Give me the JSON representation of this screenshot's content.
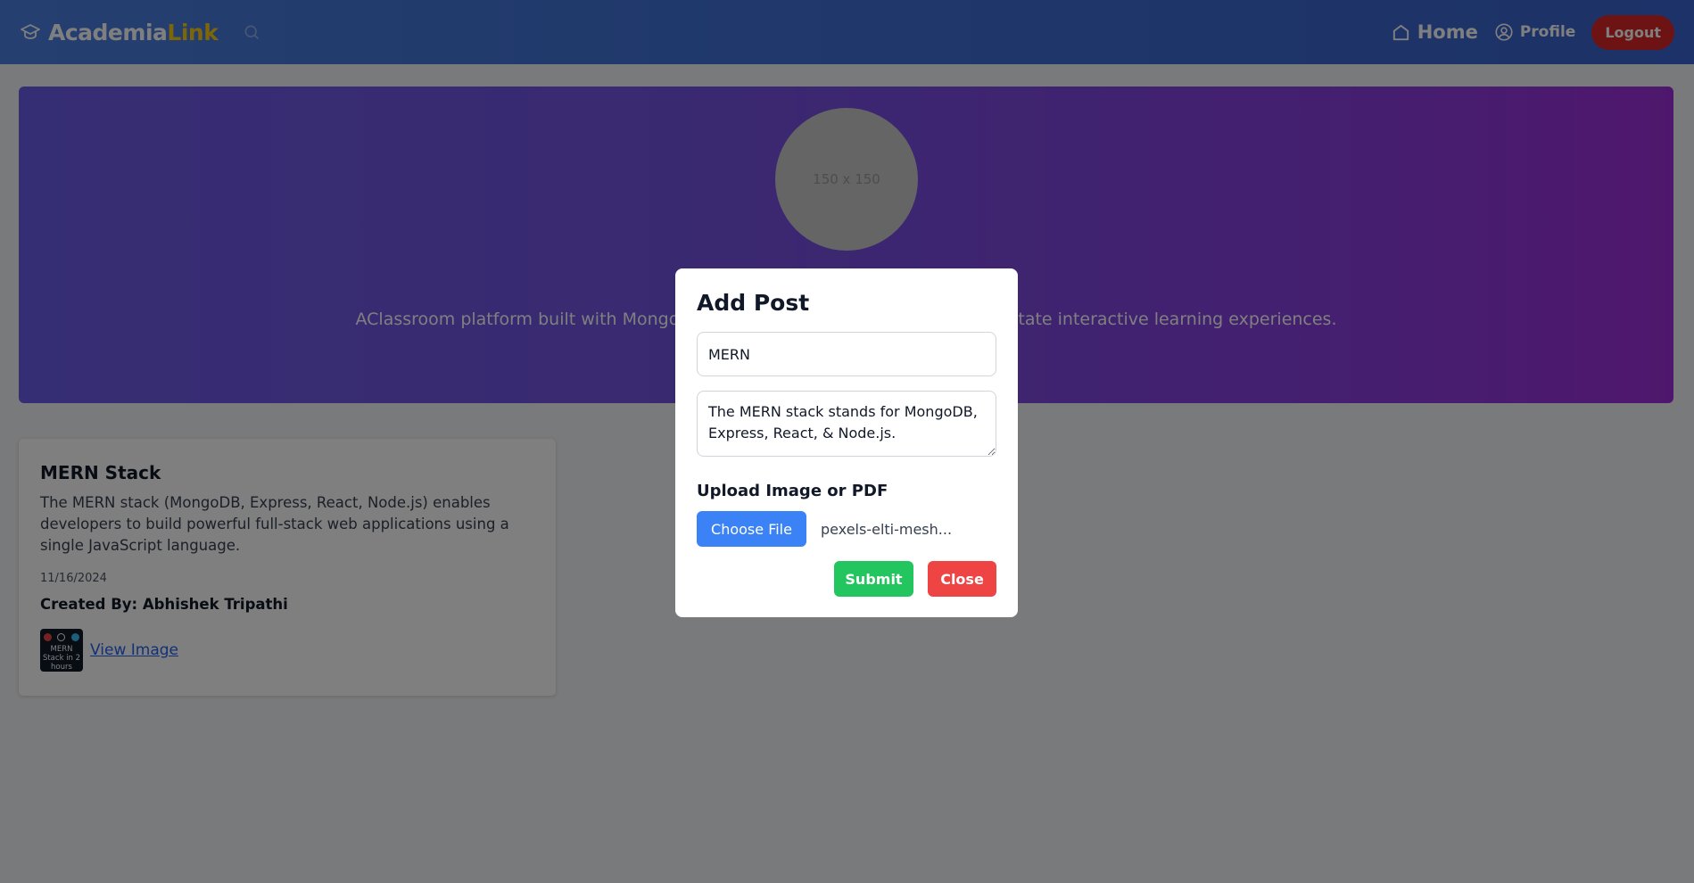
{
  "navbar": {
    "brand_primary": "Academia",
    "brand_accent": "Link",
    "home_label": "Home",
    "profile_label": "Profile",
    "logout_label": "Logout",
    "icons": [
      "graduation-cap-icon",
      "search-icon",
      "home-icon",
      "user-circle-icon"
    ]
  },
  "hero": {
    "avatar_placeholder": "150 x 150",
    "description": "AClassroom platform built with MongoDB, Express, React, and Node.js to facilitate interactive learning experiences."
  },
  "post": {
    "title": "MERN Stack",
    "body": "The MERN stack (MongoDB, Express, React, Node.js) enables developers to build powerful full-stack web applications using a single JavaScript language.",
    "date": "11/16/2024",
    "author": "Created By: Abhishek Tripathi",
    "thumbnail_text": "MERN Stack in 2 hours",
    "view_link": "View Image"
  },
  "modal": {
    "title": "Add Post",
    "title_value": "MERN",
    "description_value": "The MERN stack stands for MongoDB, Express, React, & Node.js.",
    "upload_label": "Upload Image or PDF",
    "choose_file_label": "Choose File",
    "file_name": "pexels-elti-mesh...",
    "submit_label": "Submit",
    "close_label": "Close"
  },
  "colors": {
    "navbar": "#3f6fd6",
    "brand_accent": "#facc15",
    "logout": "#dc2626",
    "hero_start": "#6d5ce8",
    "hero_end": "#9d2fdb",
    "choose_file": "#3b82f6",
    "submit": "#22c55e",
    "close": "#ef4444"
  }
}
